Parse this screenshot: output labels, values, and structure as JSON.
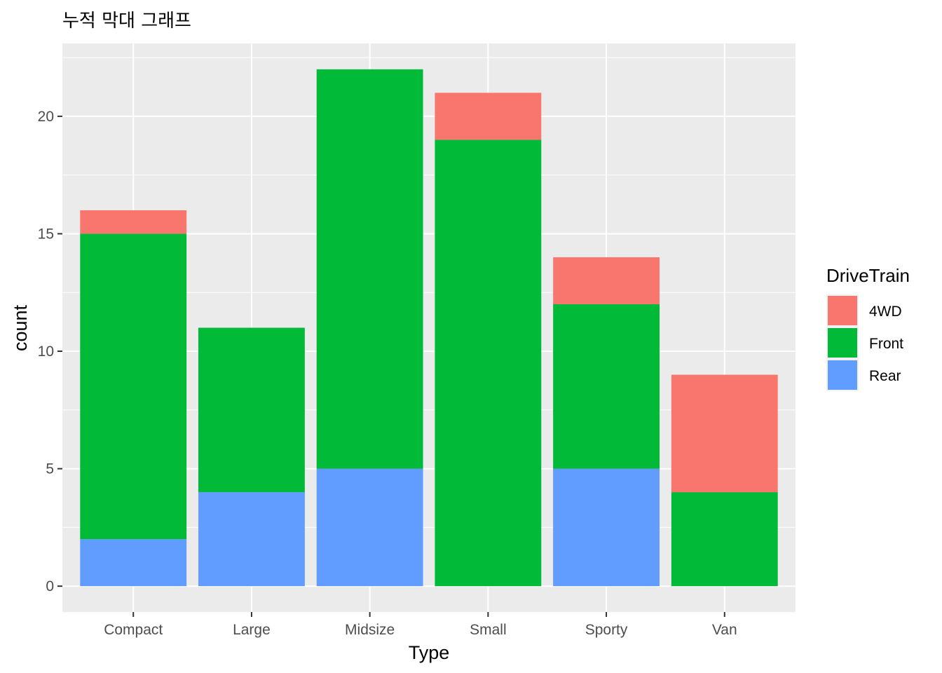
{
  "chart_data": {
    "type": "bar",
    "stacked": true,
    "title": "누적 막대 그래프",
    "xlabel": "Type",
    "ylabel": "count",
    "categories": [
      "Compact",
      "Large",
      "Midsize",
      "Small",
      "Sporty",
      "Van"
    ],
    "series": [
      {
        "name": "4WD",
        "color": "#F8766D",
        "values": [
          1,
          0,
          0,
          2,
          2,
          5
        ]
      },
      {
        "name": "Front",
        "color": "#00BA38",
        "values": [
          13,
          7,
          17,
          19,
          7,
          4
        ]
      },
      {
        "name": "Rear",
        "color": "#619CFF",
        "values": [
          2,
          4,
          5,
          0,
          5,
          0
        ]
      }
    ],
    "stack_order_bottom_to_top": [
      "Rear",
      "Front",
      "4WD"
    ],
    "ylim": [
      -1.1,
      23.1
    ],
    "yticks": [
      0,
      5,
      10,
      15,
      20
    ],
    "ytick_labels": [
      "0",
      "5",
      "10",
      "15",
      "20"
    ],
    "grid": true,
    "legend": {
      "title": "DriveTrain",
      "position": "right",
      "entries": [
        "4WD",
        "Front",
        "Rear"
      ]
    }
  }
}
